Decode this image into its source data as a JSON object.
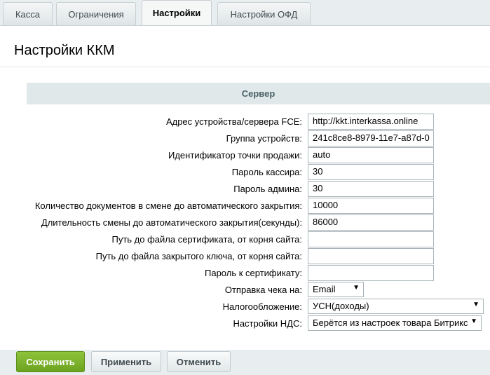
{
  "tabs": [
    {
      "label": "Касса"
    },
    {
      "label": "Ограничения"
    },
    {
      "label": "Настройки"
    },
    {
      "label": "Настройки ОФД"
    }
  ],
  "panel": {
    "title": "Настройки ККМ",
    "section_title": "Сервер"
  },
  "fields": [
    {
      "label": "Адрес устройства/сервера FCE:",
      "value": "http://kkt.interkassa.online"
    },
    {
      "label": "Группа устройств:",
      "value": "241c8ce8-8979-11e7-a87d-0"
    },
    {
      "label": "Идентификатор точки продажи:",
      "value": "auto"
    },
    {
      "label": "Пароль кассира:",
      "value": "30"
    },
    {
      "label": "Пароль админа:",
      "value": "30"
    },
    {
      "label": "Количество документов в смене до автоматического закрытия:",
      "value": "10000"
    },
    {
      "label": "Длительность смены до автоматического закрытия(секунды):",
      "value": "86000"
    },
    {
      "label": "Путь до файла сертификата, от корня сайта:",
      "value": ""
    },
    {
      "label": "Путь до файла закрытого ключа, от корня сайта:",
      "value": ""
    },
    {
      "label": "Пароль к сертификату:",
      "value": ""
    }
  ],
  "selects": [
    {
      "label": "Отправка чека на:",
      "value": "Email"
    },
    {
      "label": "Налогообложение:",
      "value": "УСН(доходы)"
    },
    {
      "label": "Настройки НДС:",
      "value": "Берётся из настроек товара Битрикс"
    }
  ],
  "buttons": {
    "save": "Сохранить",
    "apply": "Применить",
    "cancel": "Отменить"
  },
  "icons": {
    "dropdown": "chevron-down-icon"
  },
  "colors": {
    "save_button": "#7ab32e",
    "section_head_bg": "#e0e8ea",
    "page_bg": "#e8edef"
  }
}
